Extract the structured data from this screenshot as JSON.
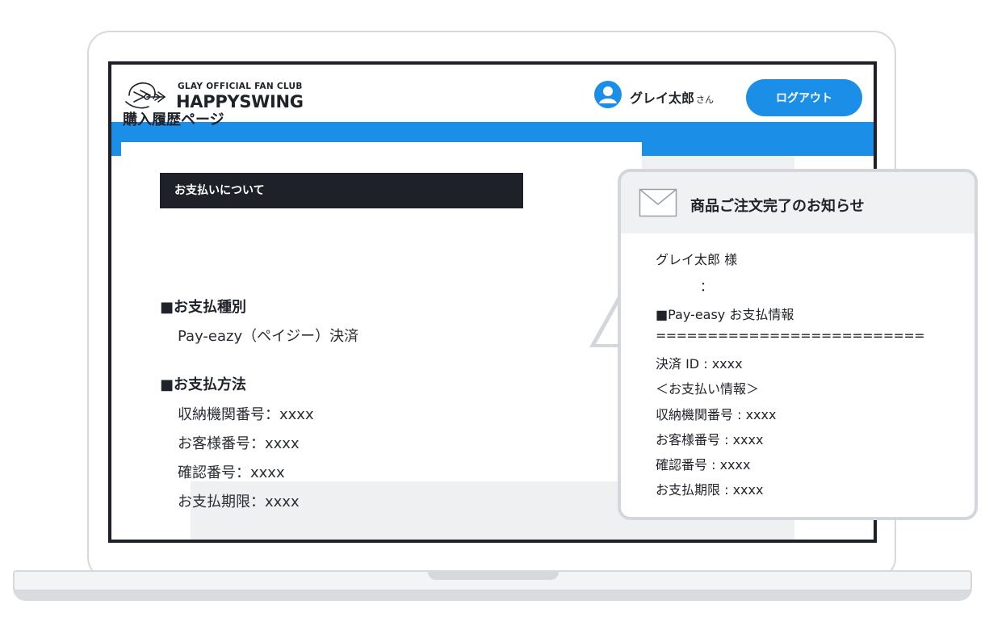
{
  "header": {
    "brand_small": "GLAY OFFICIAL FAN CLUB",
    "brand_name": "HAPPYSWING",
    "user_name": "グレイ太郎",
    "user_suffix": "さん",
    "logout_label": "ログアウト"
  },
  "page": {
    "title": "購入履歴ページ",
    "section_header": "お支払いについて",
    "payment_type_heading": "■お支払種別",
    "payment_type_value": "Pay-eazy（ペイジー）決済",
    "payment_method_heading": "■お支払方法",
    "details": [
      "収納機関番号：xxxx",
      "お客様番号：xxxx",
      "確認番号：xxxx",
      "お支払期限：xxxx"
    ]
  },
  "email_popup": {
    "title": "商品ご注文完了のお知らせ",
    "lines": [
      "グレイ太郎 様",
      "：",
      "■Pay-easy お支払情報",
      "==========================",
      "決済 ID : xxxx",
      "＜お支払い情報＞",
      "収納機関番号 : xxxx",
      "お客様番号 : xxxx",
      "確認番号 : xxxx",
      "お支払期限 : xxxx"
    ]
  },
  "colors": {
    "accent": "#1b8ee8",
    "dark": "#1e2128",
    "panel": "#eef0f2"
  }
}
